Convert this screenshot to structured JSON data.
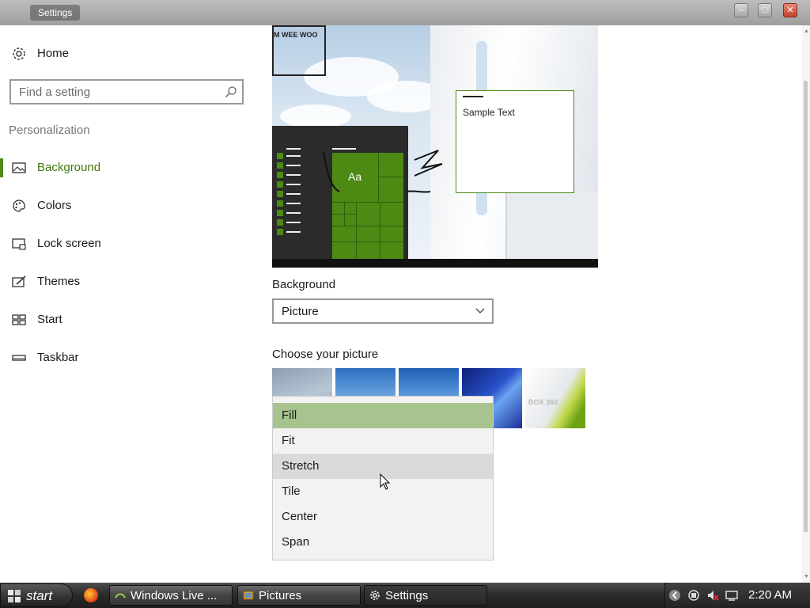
{
  "window": {
    "title": "Settings"
  },
  "sidebar": {
    "home": "Home",
    "search_placeholder": "Find a setting",
    "section": "Personalization",
    "items": [
      {
        "label": "Background",
        "active": true
      },
      {
        "label": "Colors"
      },
      {
        "label": "Lock screen"
      },
      {
        "label": "Themes"
      },
      {
        "label": "Start"
      },
      {
        "label": "Taskbar"
      }
    ]
  },
  "preview": {
    "sample_text": "Sample Text",
    "tile_text": "Aa",
    "ghost_tile_text": "M WEE WOO"
  },
  "background": {
    "label": "Background",
    "value": "Picture"
  },
  "choose_picture": {
    "label": "Choose your picture",
    "thumb5_text": "BOX 360"
  },
  "fit_menu": {
    "options": [
      "Fill",
      "Fit",
      "Stretch",
      "Tile",
      "Center",
      "Span"
    ],
    "selected": "Fill",
    "hovered": "Stretch"
  },
  "taskbar": {
    "start": "start",
    "buttons": [
      "Windows Live ...",
      "Pictures",
      "Settings"
    ],
    "active": "Settings",
    "clock": "2:20 AM"
  },
  "colors": {
    "accent": "#4c8a14",
    "selected_option": "#a8c48e"
  }
}
